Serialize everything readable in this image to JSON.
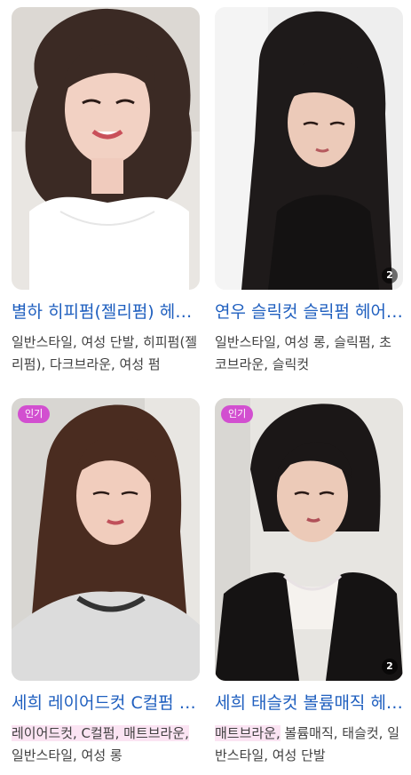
{
  "colors": {
    "title_link": "#1f5fbf",
    "tag_text": "#404040",
    "popular_badge_bg": "#d24fd0",
    "tag_highlight_bg": "#fbe4f3"
  },
  "cards": [
    {
      "title": "별하 히피펌(젤리펌) 헤어스타일",
      "tags": "일반스타일, 여성 단발, 히피펌(젤리펌), 다크브라운, 여성 펌",
      "popular_badge": "",
      "image_count": "",
      "image_icon": "woman-curly-hair-photo"
    },
    {
      "title": "연우 슬릭컷 슬릭펌 헤어스타일",
      "tags": "일반스타일, 여성 롱, 슬릭펌, 초코브라운, 슬릭컷",
      "popular_badge": "",
      "image_count": "2",
      "image_icon": "woman-long-straight-hair-photo"
    },
    {
      "title": "세희 레이어드컷 C컬펌 헤어스타일",
      "tags_highlight": "레이어드컷, C컬펌, 매트브라운,",
      "tags_rest": " 일반스타일, 여성 롱",
      "popular_badge": "인기",
      "image_count": "",
      "image_icon": "woman-layered-cut-photo"
    },
    {
      "title": "세희 태슬컷 볼륨매직 헤어스타일",
      "tags_highlight": "매트브라운,",
      "tags_rest": " 볼륨매직, 태슬컷, 일반스타일, 여성 단발",
      "popular_badge": "인기",
      "image_count": "2",
      "image_icon": "woman-bob-cut-photo"
    }
  ]
}
